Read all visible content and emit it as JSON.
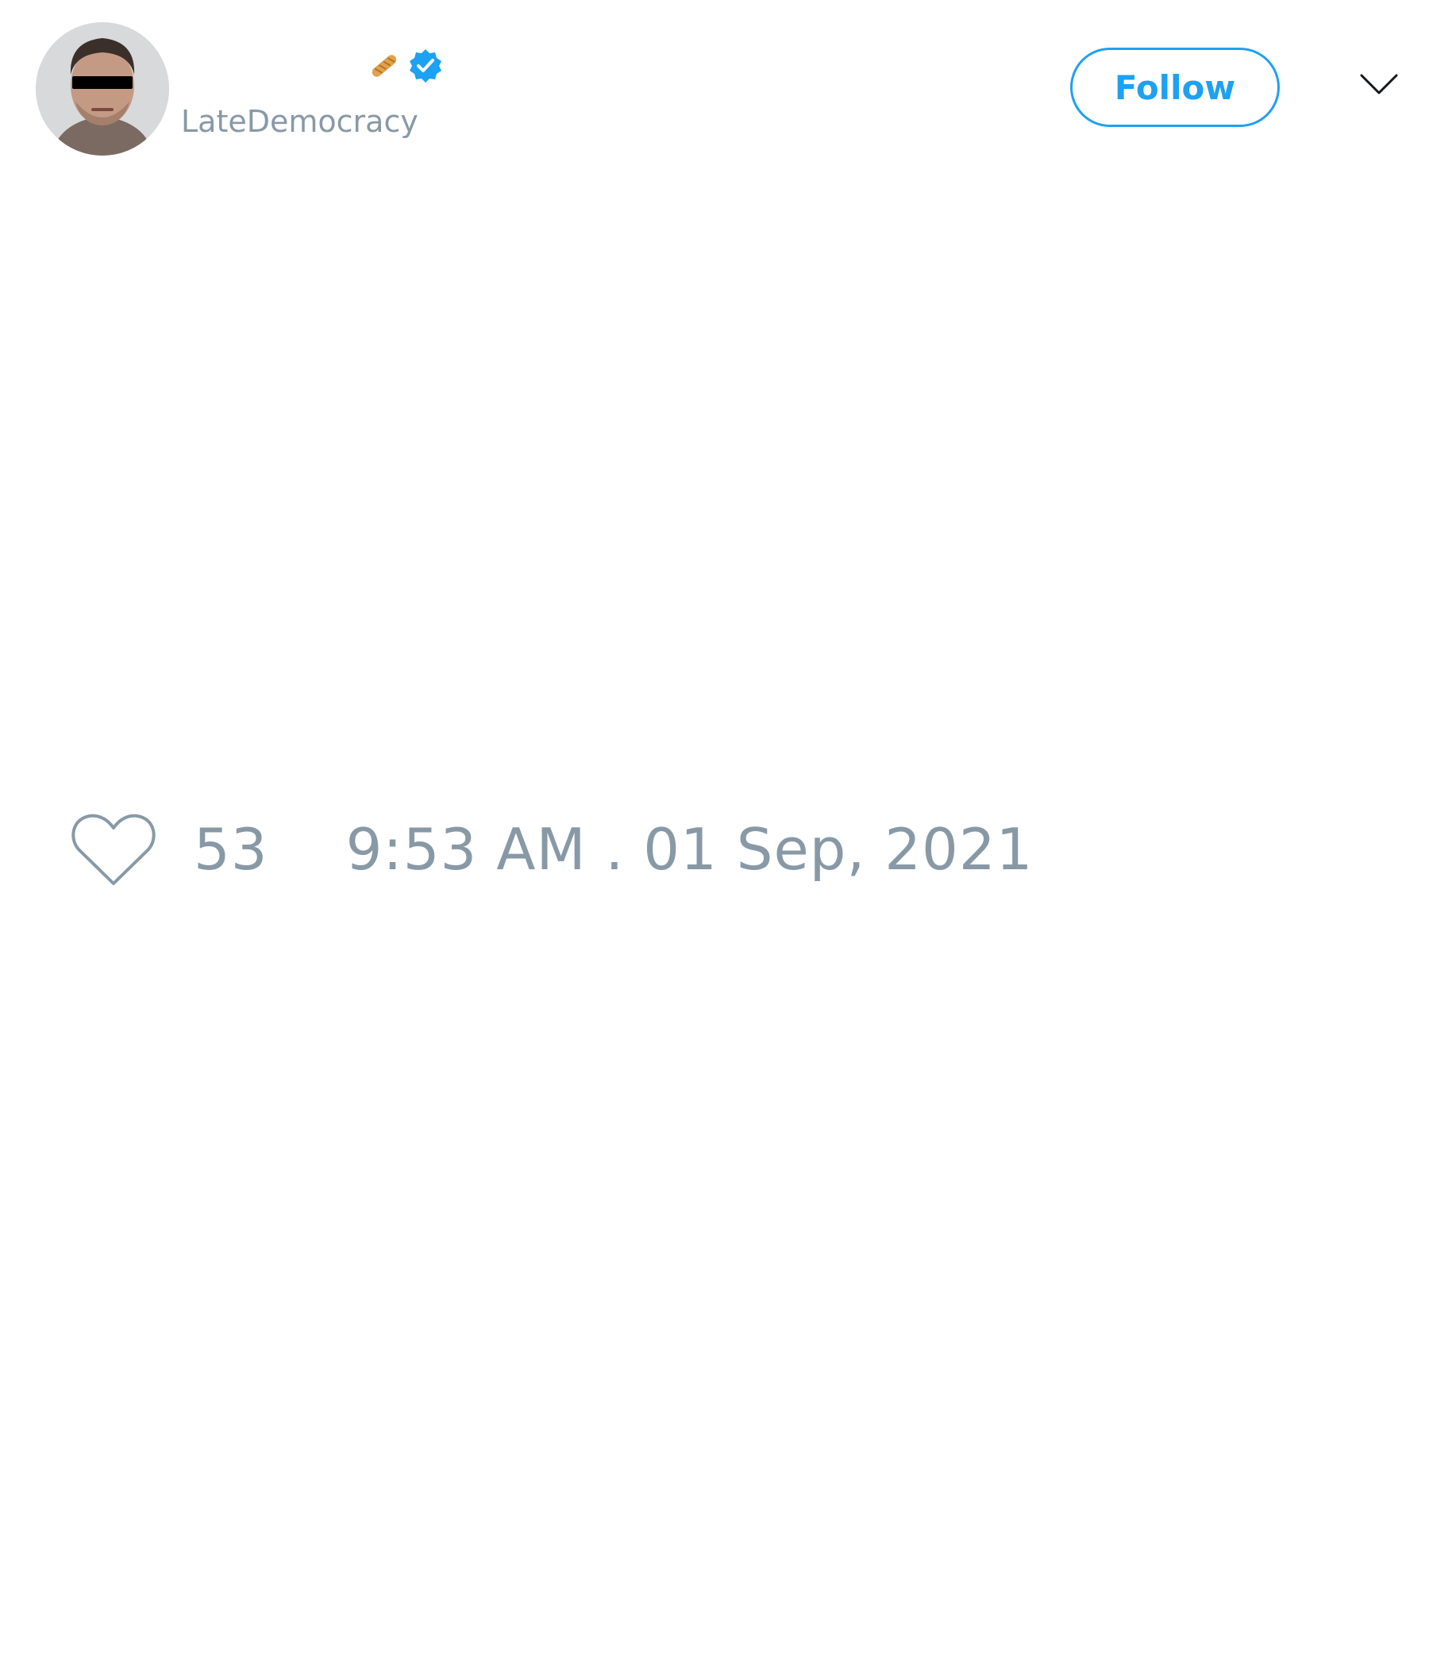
{
  "tweet": {
    "author": {
      "display_name": "",
      "handle": "LateDemocracy",
      "verified": true,
      "name_emoji": "baguette-icon",
      "avatar": "profile-photo"
    },
    "follow_label": "Follow",
    "menu_icon": "chevron-down-icon",
    "text": "",
    "likes": "53",
    "timestamp": "9:53 AM . 01 Sep, 2021"
  },
  "colors": {
    "accent": "#1da1f2",
    "muted": "#8899a6",
    "text": "#14171a",
    "background": "#ffffff"
  }
}
